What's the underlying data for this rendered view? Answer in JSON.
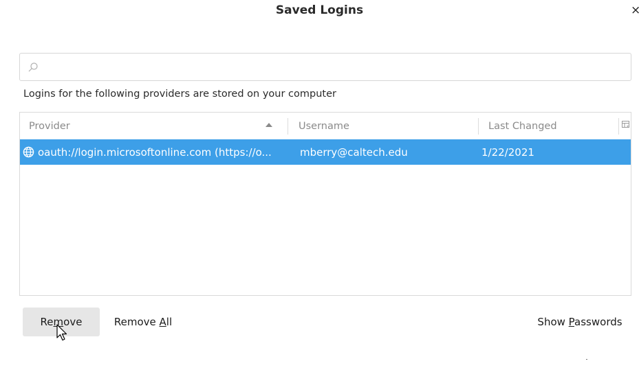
{
  "dialog": {
    "title": "Saved Logins",
    "close_label": "×"
  },
  "search": {
    "placeholder": "",
    "value": ""
  },
  "intro_text": "Logins for the following providers are stored on your computer",
  "table": {
    "columns": {
      "provider": "Provider",
      "username": "Username",
      "last_changed": "Last Changed"
    },
    "sort_column": "provider",
    "sort_direction": "ascending",
    "rows": [
      {
        "provider": "oauth://login.microsoftonline.com (https://o...",
        "username": "mberry@caltech.edu",
        "last_changed": "1/22/2021",
        "selected": true
      }
    ]
  },
  "buttons": {
    "remove": {
      "pre": "Re",
      "accel": "m",
      "post": "ove"
    },
    "remove_all": {
      "pre": "Remove ",
      "accel": "A",
      "post": "ll"
    },
    "show_passwords": {
      "pre": "Show ",
      "accel": "P",
      "post": "asswords"
    }
  },
  "colors": {
    "selection": "#3d9fe8",
    "button_bg": "#e6e6e6"
  }
}
